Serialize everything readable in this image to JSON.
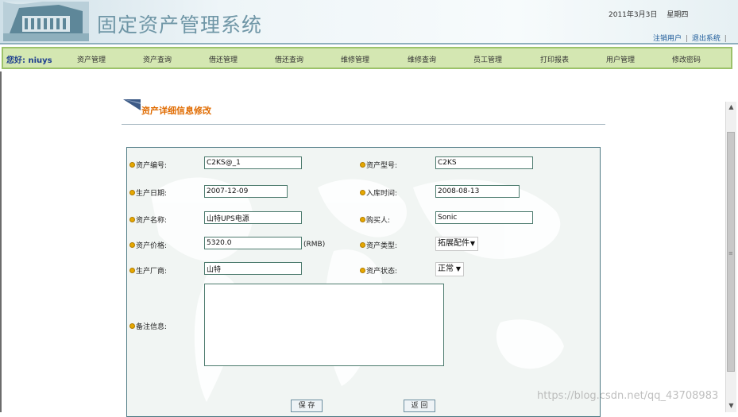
{
  "header": {
    "title": "固定资产管理系统",
    "date": "2011年3月3日",
    "weekday": "星期四",
    "links": {
      "logout": "注销用户",
      "exit": "退出系统",
      "sep": "|"
    }
  },
  "nav": {
    "greeting_prefix": "您好:",
    "username": "niuys",
    "items": [
      "资产管理",
      "资产查询",
      "借还管理",
      "借还查询",
      "维修管理",
      "维修查询",
      "员工管理",
      "打印报表",
      "用户管理",
      "修改密码"
    ]
  },
  "page": {
    "title": "资产详细信息修改"
  },
  "form": {
    "asset_no": {
      "label": "资产编号:",
      "value": "C2KS@_1"
    },
    "asset_model": {
      "label": "资产型号:",
      "value": "C2KS"
    },
    "production_date": {
      "label": "生产日期:",
      "value": "2007-12-09"
    },
    "storage_date": {
      "label": "入库时间:",
      "value": "2008-08-13"
    },
    "asset_name": {
      "label": "资产名称:",
      "value": "山特UPS电源"
    },
    "buyer": {
      "label": "购买人:",
      "value": "Sonic"
    },
    "price": {
      "label": "资产价格:",
      "value": "5320.0",
      "unit": "(RMB)"
    },
    "asset_type": {
      "label": "资产类型:",
      "value": "拓展配件"
    },
    "manufacturer": {
      "label": "生产厂商:",
      "value": "山特"
    },
    "asset_status": {
      "label": "资产状态:",
      "value": "正常"
    },
    "remark": {
      "label": "备注信息:",
      "value": ""
    },
    "save_label": "保 存",
    "back_label": "返 回"
  },
  "watermark": "https://blog.csdn.net/qq_43708983",
  "colors": {
    "nav_bg": "#d4e7b2",
    "title_orange": "#e06b00",
    "panel_border": "#4d7983"
  }
}
